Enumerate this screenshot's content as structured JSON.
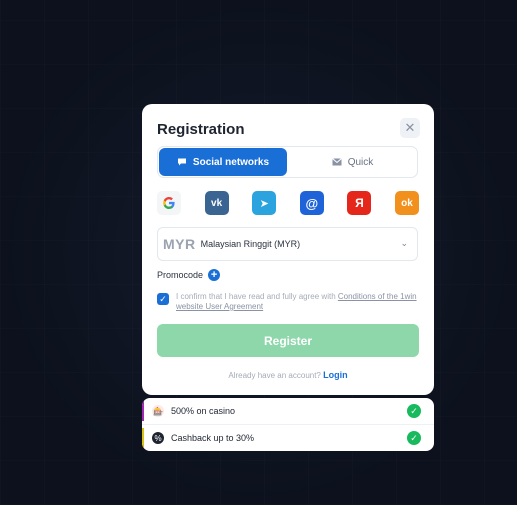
{
  "registration": {
    "title": "Registration",
    "close_symbol": "✕",
    "tabs": [
      {
        "label": "Social networks",
        "icon": "chat-bubble-icon",
        "active": true
      },
      {
        "label": "Quick",
        "icon": "envelope-icon",
        "active": false
      }
    ],
    "socials": [
      {
        "name": "google",
        "glyph": "G"
      },
      {
        "name": "vk",
        "glyph": "vk"
      },
      {
        "name": "telegram",
        "glyph": "➤"
      },
      {
        "name": "mail",
        "glyph": "@"
      },
      {
        "name": "yandex",
        "glyph": "Я"
      },
      {
        "name": "odnoklassniki",
        "glyph": "ok"
      }
    ],
    "currency": {
      "code": "MYR",
      "name": "Malaysian Ringgit (MYR)"
    },
    "promocode_label": "Promocode",
    "agree_text": "I confirm that I have read and fully agree with",
    "agree_link": "Conditions of the 1win website User Agreement",
    "register_label": "Register",
    "have_account_text": "Already have an account?",
    "login_label": "Login"
  },
  "bonuses": [
    {
      "text": "500% on casino",
      "bar_color": "#a02bb0"
    },
    {
      "text": "Cashback up to 30%",
      "bar_color": "#d8c21a"
    }
  ],
  "colors": {
    "accent": "#1a6fd6",
    "register_button": "#8ed7ab",
    "success": "#19b95e"
  }
}
